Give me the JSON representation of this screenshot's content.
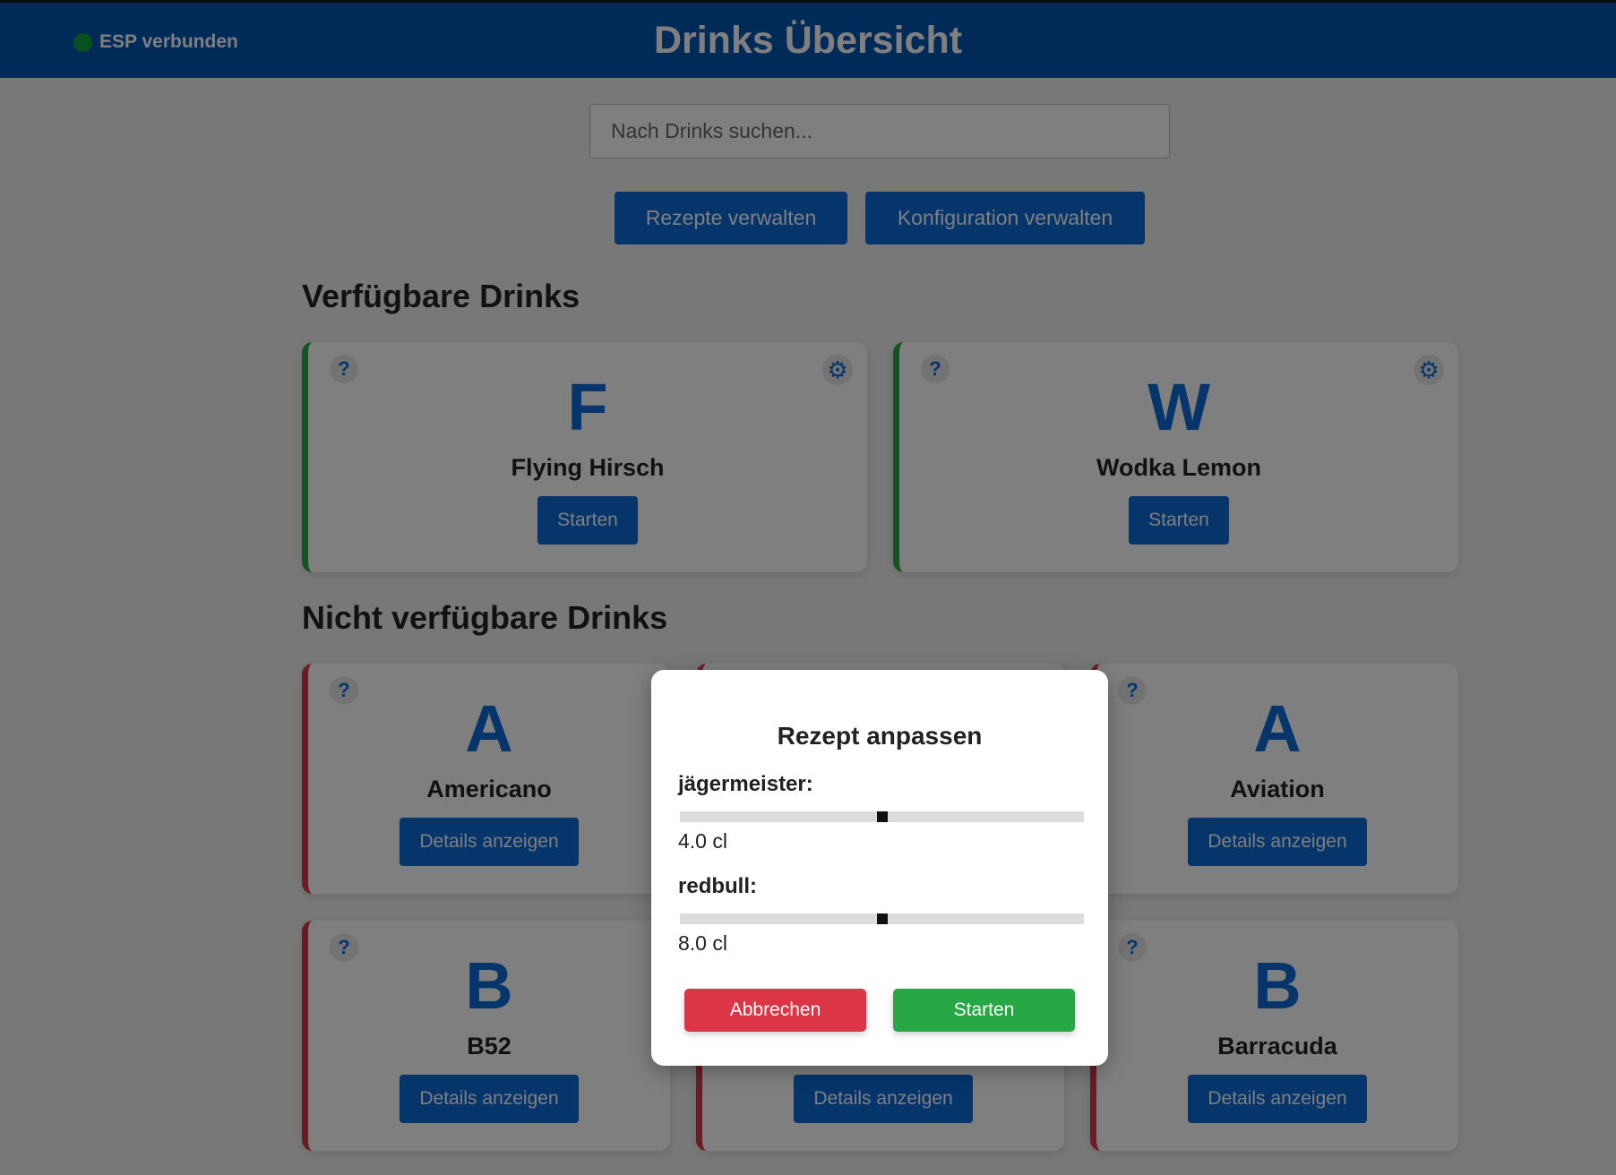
{
  "header": {
    "status_label": "ESP verbunden",
    "title": "Drinks Übersicht"
  },
  "search": {
    "placeholder": "Nach Drinks suchen...",
    "value": ""
  },
  "actions": {
    "recipes_label": "Rezepte verwalten",
    "config_label": "Konfiguration verwalten"
  },
  "sections": {
    "available_title": "Verfügbare Drinks",
    "unavailable_title": "Nicht verfügbare Drinks"
  },
  "help_icon": "?",
  "settings_icon": "⚙",
  "available": [
    {
      "letter": "F",
      "name": "Flying Hirsch",
      "button": "Starten"
    },
    {
      "letter": "W",
      "name": "Wodka Lemon",
      "button": "Starten"
    }
  ],
  "unavailable": [
    {
      "letter": "A",
      "name": "Americano",
      "button": "Details anzeigen"
    },
    {
      "letter": "A",
      "name": "Aviation",
      "button": "Details anzeigen"
    },
    {
      "letter": "B",
      "name": "B52",
      "button": "Details anzeigen"
    },
    {
      "button": "Details anzeigen"
    },
    {
      "letter": "B",
      "name": "Barracuda",
      "button": "Details anzeigen"
    }
  ],
  "modal": {
    "title": "Rezept anpassen",
    "ingredients": [
      {
        "label": "jägermeister:",
        "value": "4.0 cl",
        "fraction": 0.5
      },
      {
        "label": "redbull:",
        "value": "8.0 cl",
        "fraction": 0.5
      }
    ],
    "cancel_label": "Abbrechen",
    "start_label": "Starten"
  },
  "colors": {
    "header_bg": "#0056b3",
    "primary": "#0a6ad6",
    "available_border": "#28a745",
    "unavailable_border": "#dc3545",
    "cancel": "#dc3545",
    "start": "#28a745",
    "connected": "#10a040"
  }
}
